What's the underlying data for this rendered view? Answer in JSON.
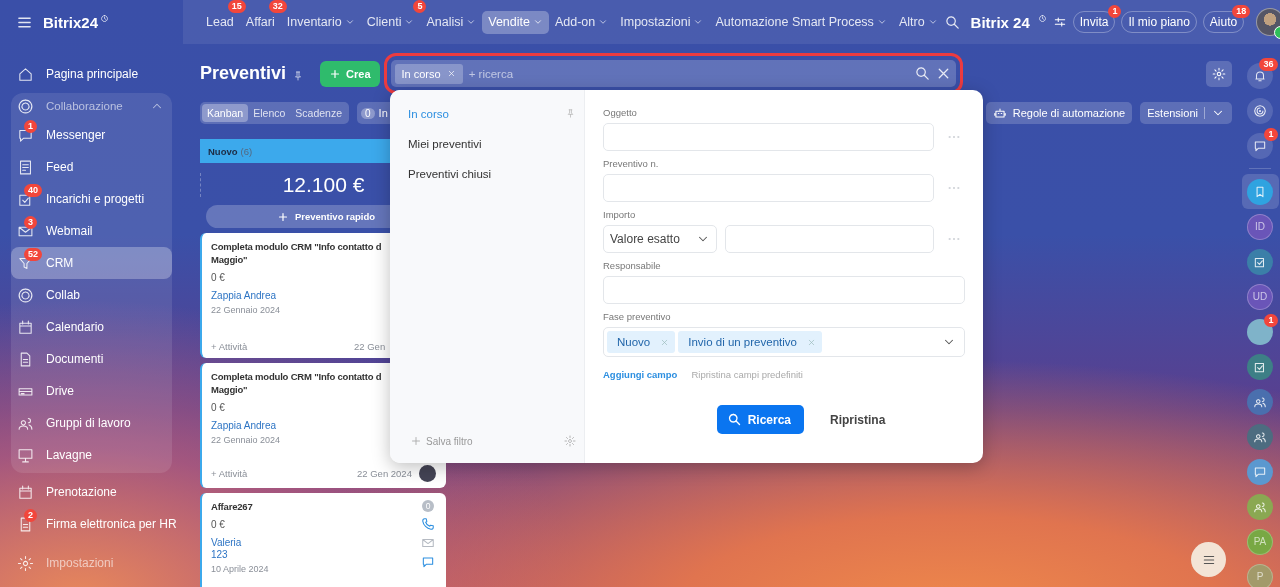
{
  "topbar": {
    "logo": "Bitrix24",
    "nav": [
      {
        "label": "Lead",
        "badge": "15",
        "menu": false,
        "selected": false
      },
      {
        "label": "Affari",
        "badge": "32",
        "menu": false,
        "selected": false
      },
      {
        "label": "Inventario",
        "menu": true,
        "selected": false
      },
      {
        "label": "Clienti",
        "badge": "5",
        "menu": true,
        "selected": false
      },
      {
        "label": "Analisi",
        "menu": true,
        "selected": false
      },
      {
        "label": "Vendite",
        "menu": true,
        "selected": true
      },
      {
        "label": "Add-on",
        "menu": true,
        "selected": false
      },
      {
        "label": "Impostazioni",
        "menu": true,
        "selected": false
      },
      {
        "label": "Automazione Smart Process",
        "menu": true,
        "selected": false
      },
      {
        "label": "Altro",
        "menu": true,
        "selected": false
      }
    ],
    "brand": "Bitrix 24",
    "actions": [
      {
        "label": "Invita",
        "badge": "1"
      },
      {
        "label": "Il mio piano"
      },
      {
        "label": "Aiuto",
        "badge": "18"
      }
    ]
  },
  "sidebar": {
    "top": [
      {
        "label": "Pagina principale",
        "selected": false
      }
    ],
    "group": {
      "label": "Collaborazione",
      "expanded": true,
      "items": [
        {
          "label": "Messenger",
          "badge": "1",
          "selected": false
        },
        {
          "label": "Feed",
          "selected": false
        },
        {
          "label": "Incarichi e progetti",
          "badge": "40",
          "selected": false
        },
        {
          "label": "Webmail",
          "badge": "3",
          "selected": false
        },
        {
          "label": "CRM",
          "badge": "52",
          "selected": true
        },
        {
          "label": "Collab",
          "selected": false
        },
        {
          "label": "Calendario",
          "selected": false
        },
        {
          "label": "Documenti",
          "selected": false
        },
        {
          "label": "Drive",
          "selected": false
        },
        {
          "label": "Gruppi di lavoro",
          "selected": false
        },
        {
          "label": "Lavagne",
          "selected": false
        }
      ]
    },
    "after": [
      {
        "label": "Prenotazione",
        "selected": false
      },
      {
        "label": "Firma elettronica per HR",
        "badge": "2",
        "selected": false
      }
    ],
    "footer": "Impostazioni"
  },
  "page": {
    "title": "Preventivi",
    "create": "Crea",
    "search": {
      "chips": [
        "In corso"
      ],
      "placeholder": "+ ricerca"
    },
    "views": [
      {
        "label": "Kanban",
        "selected": true
      },
      {
        "label": "Elenco",
        "selected": false
      },
      {
        "label": "Scadenze",
        "selected": false
      }
    ],
    "counter": {
      "count": "0",
      "label": "In"
    },
    "automation": "Regole di automazione",
    "extensions": "Estensioni"
  },
  "kanban": {
    "column": {
      "title": "Nuovo",
      "count": "(6)",
      "total": "12.100 €",
      "quick_add": "Preventivo rapido"
    },
    "cards": [
      {
        "kind": "full",
        "title": "Completa modulo CRM \"Info contatto d\nMaggio\"",
        "amount": "0 €",
        "contacts": [
          "Zappia Andrea"
        ],
        "date": "22 Gennaio 2024",
        "activity": "+ Attività",
        "activity_date": "22 Gen",
        "avatar": false
      },
      {
        "kind": "full",
        "title": "Completa modulo CRM \"Info contatto d\nMaggio\"",
        "amount": "0 €",
        "contacts": [
          "Zappia Andrea"
        ],
        "date": "22 Gennaio 2024",
        "activity": "+ Attività",
        "activity_date": "22 Gen 2024",
        "avatar": true
      },
      {
        "kind": "compact",
        "title": "Affare267",
        "amount": "0 €",
        "contacts": [
          "Valeria",
          "123"
        ],
        "date": "10 Aprile 2024",
        "counter": "0"
      }
    ]
  },
  "filter": {
    "presets": [
      {
        "label": "In corso",
        "selected": true
      },
      {
        "label": "Miei preventivi",
        "selected": false
      },
      {
        "label": "Preventivi chiusi",
        "selected": false
      }
    ],
    "save": "Salva filtro",
    "fields": [
      {
        "kind": "text",
        "label": "Oggetto"
      },
      {
        "kind": "text",
        "label": "Preventivo n."
      },
      {
        "kind": "range",
        "label": "Importo",
        "select": "Valore esatto"
      },
      {
        "kind": "person",
        "label": "Responsabile"
      },
      {
        "kind": "tags",
        "label": "Fase preventivo",
        "tags": [
          "Nuovo",
          "Invio di un preventivo"
        ]
      }
    ],
    "add_field": "Aggiungi campo",
    "reset_fields": "Ripristina campi predefiniti",
    "search": "Ricerca",
    "reset": "Ripristina"
  },
  "rail": [
    {
      "kind": "icon",
      "badge": "36",
      "selected": false
    },
    {
      "kind": "icon",
      "selected": false
    },
    {
      "kind": "icon",
      "badge": "1",
      "selected": false
    },
    {
      "kind": "separator"
    },
    {
      "kind": "icon",
      "color": "#2fa3e0",
      "selected": true
    },
    {
      "kind": "initials",
      "text": "ID",
      "color": "#6a55b8",
      "selected": false
    },
    {
      "kind": "icon",
      "color": "#3b7fa8",
      "selected": false
    },
    {
      "kind": "initials",
      "text": "UD",
      "color": "#6a55b8",
      "selected": false
    },
    {
      "kind": "avatar",
      "badge": "1",
      "color": "#7fb3c9",
      "selected": false
    },
    {
      "kind": "icon",
      "color": "#3d7f86",
      "selected": false
    },
    {
      "kind": "icon",
      "color": "#4a6fae",
      "selected": false
    },
    {
      "kind": "icon",
      "color": "#4d6c80",
      "selected": false
    },
    {
      "kind": "icon",
      "color": "#5b98cf",
      "selected": false
    },
    {
      "kind": "icon",
      "color": "#8aa852",
      "selected": false
    },
    {
      "kind": "initials",
      "text": "PA",
      "color": "#78a844",
      "selected": false
    },
    {
      "kind": "initials",
      "text": "P",
      "color": "#a29a6a",
      "selected": false
    }
  ]
}
